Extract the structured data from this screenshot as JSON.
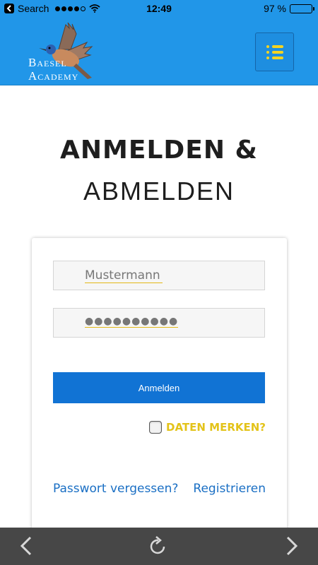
{
  "status_bar": {
    "carrier": "Search",
    "time": "12:49",
    "battery_percent": "97 %",
    "battery_level": 0.97,
    "signal_filled": 4,
    "signal_total": 5,
    "icons": [
      "back-chevron-icon",
      "wifi-icon",
      "battery-icon"
    ]
  },
  "header": {
    "logo_line1": "Baesel",
    "logo_line2": "Academy",
    "brand_color": "#2196e8",
    "menu_icon": "list-menu-icon",
    "menu_icon_color": "#f4d321"
  },
  "page": {
    "title_line1": "ANMELDEN &",
    "title_line2": "ABMELDEN"
  },
  "form": {
    "username_value": "Mustermann",
    "password_value": "●●●●●●●●●●",
    "login_label": "Anmelden",
    "login_color": "#1173d4",
    "remember_label": "DATEN MERKEN?",
    "remember_checked": false,
    "remember_color": "#e3c319",
    "forgot_password": "Passwort vergessen?",
    "register": "Registrieren",
    "link_color": "#1a6fc4"
  },
  "toolbar": {
    "icons": [
      "chevron-left-icon",
      "reload-icon",
      "chevron-right-icon"
    ]
  }
}
